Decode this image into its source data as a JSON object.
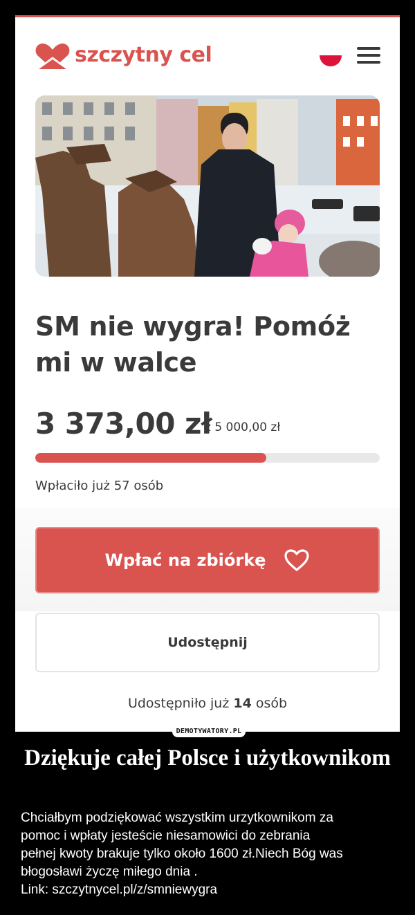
{
  "header": {
    "logo_text": "szczytny cel",
    "flag_icon": "poland-flag-icon",
    "menu_icon": "hamburger-menu-icon"
  },
  "campaign": {
    "title": "SM nie wygra! Pomóż mi w walce",
    "raised": "3 373,00 zł",
    "goal": "z 5 000,00 zł",
    "progress_fraction": 0.67,
    "donors_text": "Wpłaciło już 57 osób"
  },
  "actions": {
    "donate_label": "Wpłać na zbiórkę",
    "share_label": "Udostępnij",
    "shared_prefix": "Udostępniło już ",
    "shared_count": "14",
    "shared_suffix": " osób"
  },
  "watermark": "DEMOTYWATORY.PL",
  "caption": {
    "title": "Dziękuje całej Polsce i użytkownikom",
    "line1": "Chciałbym podziękować wszystkim urzytkownikom za",
    "line2": "pomoc i wpłaty jesteście niesamowici do zebrania",
    "line3": "pełnej kwoty brakuje tylko około 1600 zł.Niech Bóg was",
    "line4": "błogosławi życzę miłego dnia                          .",
    "line5": "Link: szczytnycel.pl/z/smniewygra"
  },
  "colors": {
    "brand": "#d9534f",
    "text": "#3a3a3a",
    "background": "#000000"
  }
}
